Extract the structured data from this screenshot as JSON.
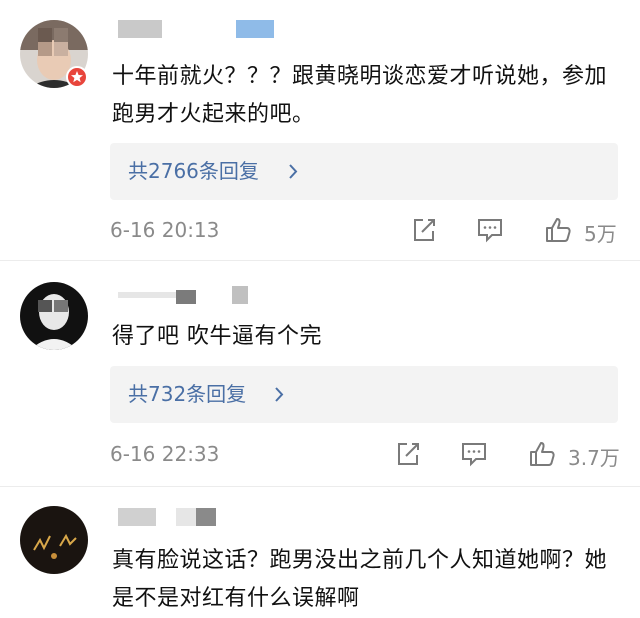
{
  "comments": [
    {
      "text": "十年前就火？？？跟黄晓明谈恋爱才听说她，参加跑男才火起来的吧。",
      "replies": "共2766条回复",
      "time": "6-16 20:13",
      "likes": "5万"
    },
    {
      "text": "得了吧 吹牛逼有个完",
      "replies": "共732条回复",
      "time": "6-16 22:33",
      "likes": "3.7万"
    },
    {
      "text": "真有脸说这话？跑男没出之前几个人知道她啊？她是不是对红有什么误解啊"
    }
  ],
  "icons": {
    "share": "share-icon",
    "comment": "comment-icon",
    "like": "thumbs-up-icon",
    "chevron": "chevron-right-icon",
    "badge": "verified-badge-icon"
  },
  "colors": {
    "link": "#4a6fa5",
    "reply_bg": "#f3f3f3",
    "meta": "#8a8a8a",
    "badge": "#e8453c"
  }
}
